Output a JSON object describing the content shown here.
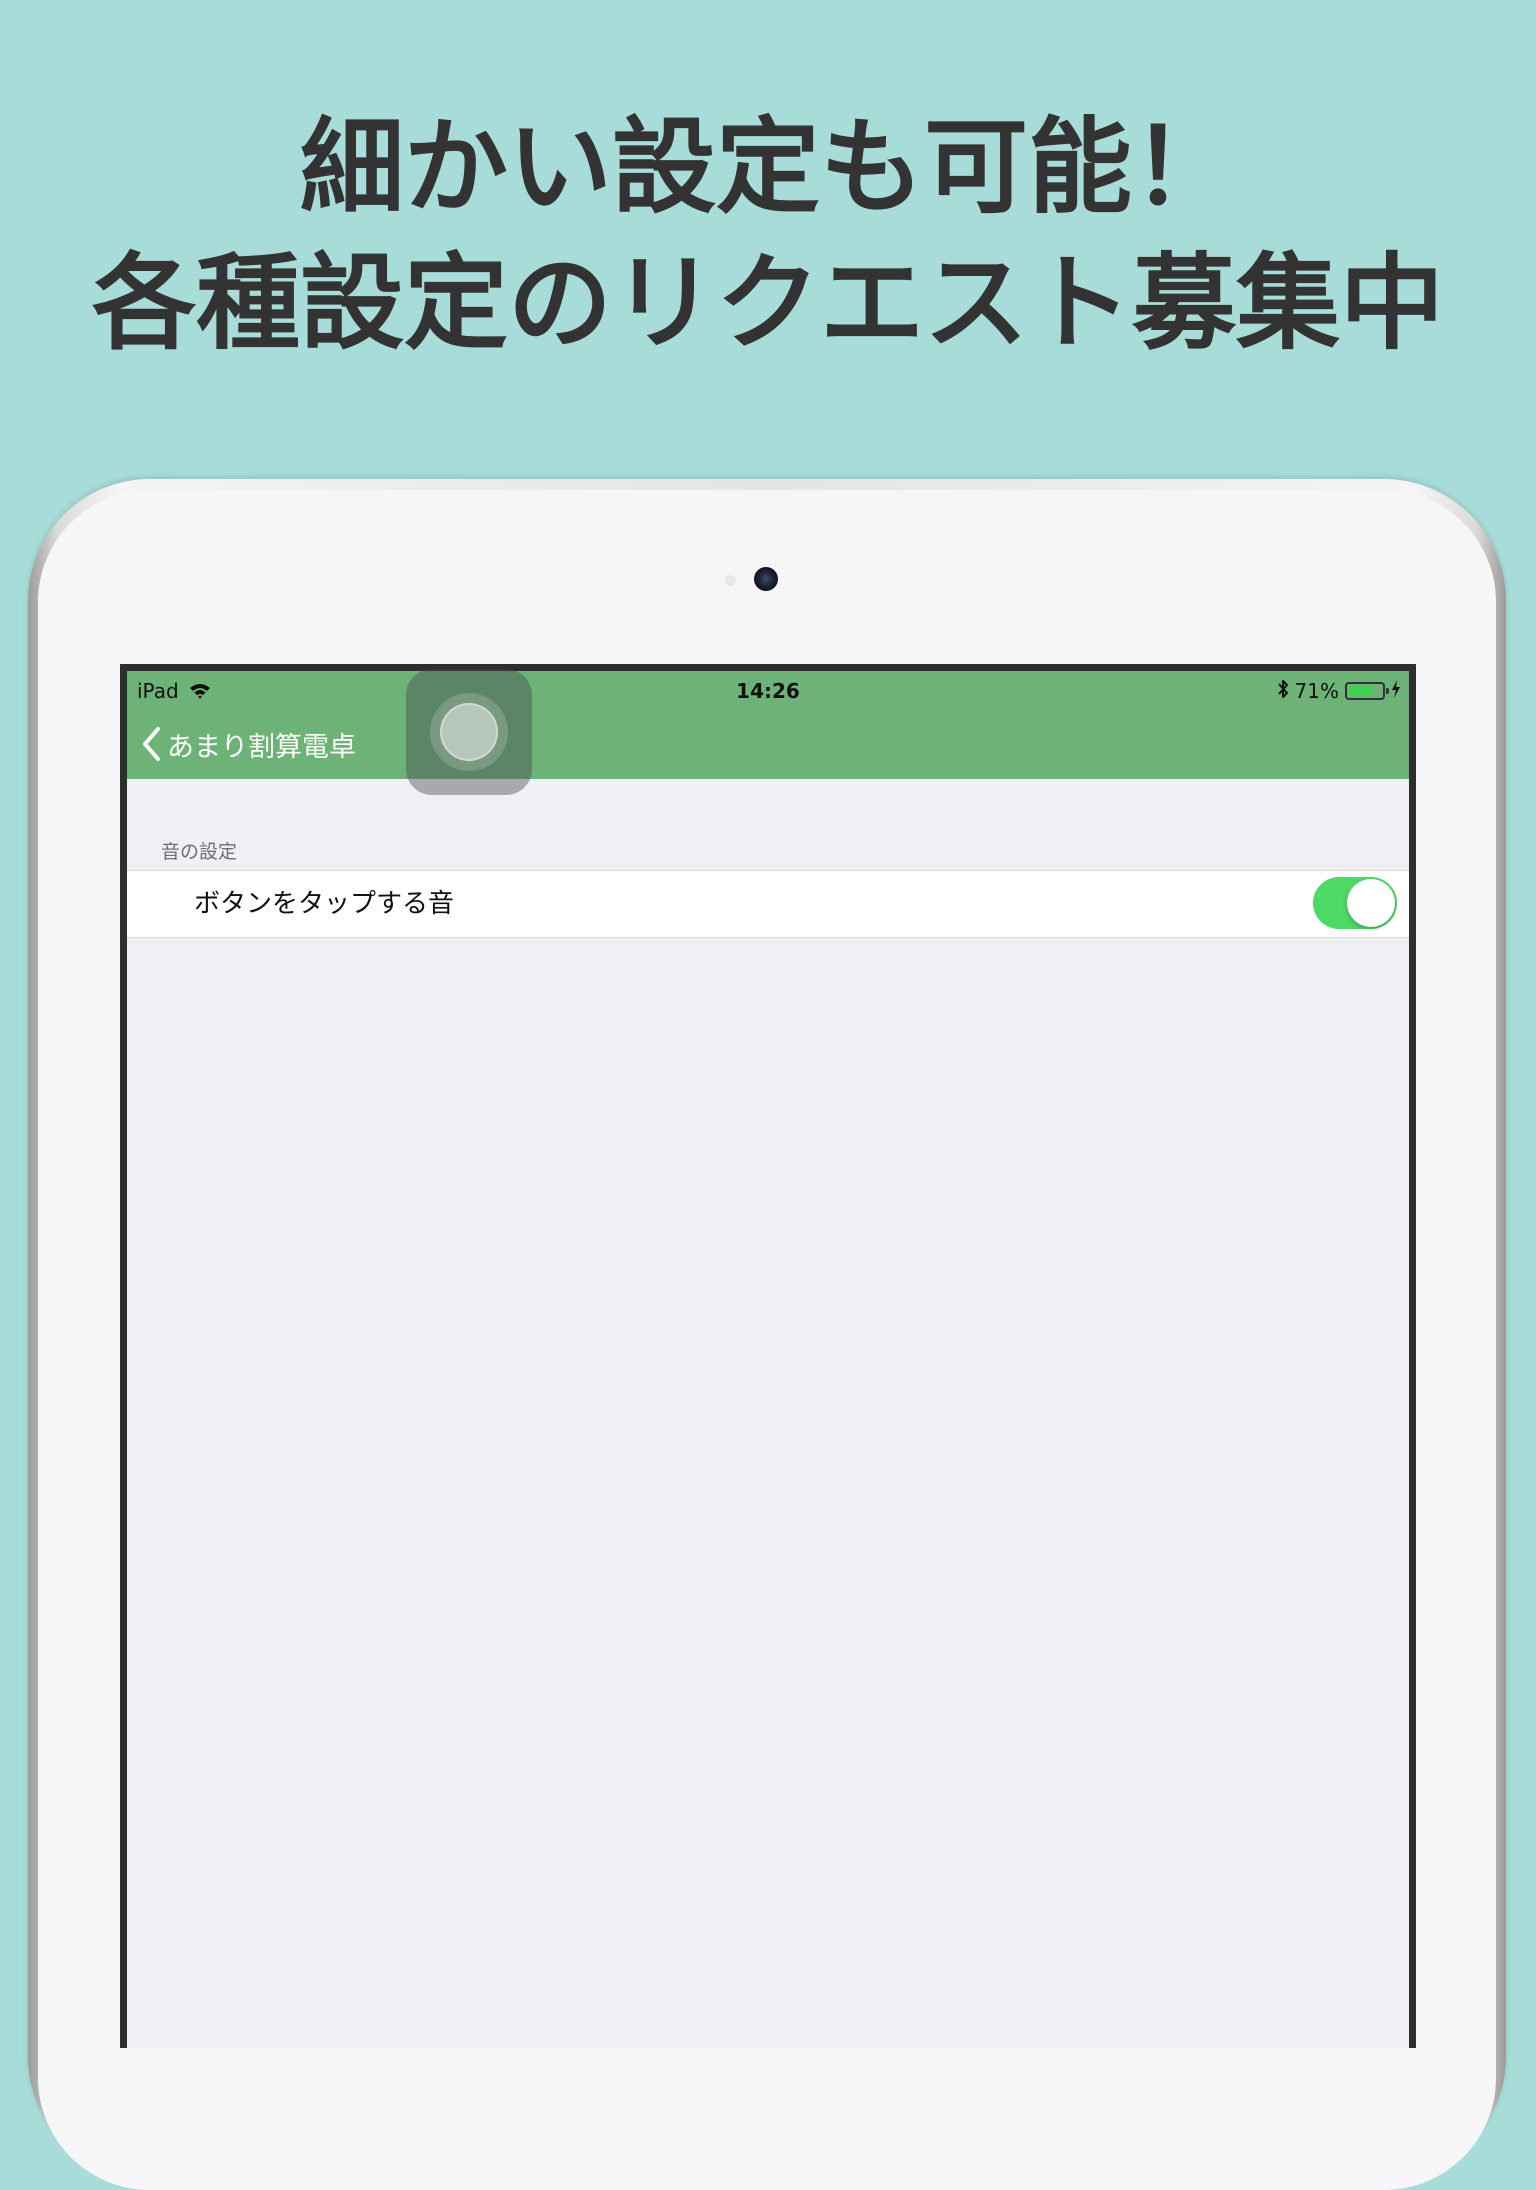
{
  "headline": {
    "line1": "細かい設定も可能！",
    "line2": "各種設定のリクエスト募集中"
  },
  "status_bar": {
    "device": "iPad",
    "time": "14:26",
    "battery_percent": "71%",
    "battery_level": 0.71,
    "icons": [
      "wifi-icon",
      "bluetooth-icon",
      "battery-icon",
      "charging-icon"
    ]
  },
  "navbar": {
    "back_label": "あまり割算電卓",
    "color": "#6db276"
  },
  "settings": {
    "section_header": "音の設定",
    "rows": [
      {
        "label": "ボタンをタップする音",
        "toggle_on": true
      }
    ]
  },
  "colors": {
    "background": "#a7dcd8",
    "headline": "#333333",
    "switch_on": "#4cd964"
  }
}
